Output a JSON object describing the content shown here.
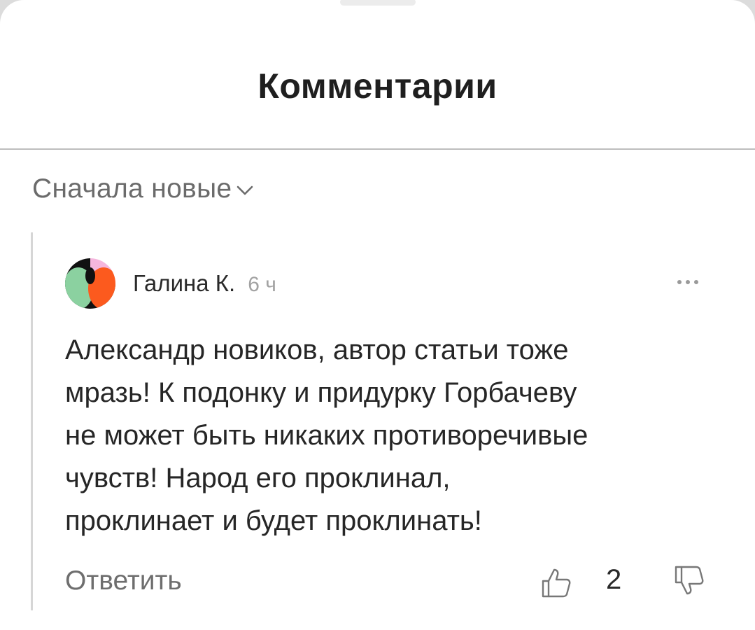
{
  "sheet": {
    "title": "Комментарии"
  },
  "sort": {
    "label": "Сначала новые",
    "icon": "chevron-down-icon"
  },
  "comment": {
    "author": "Галина К.",
    "time": "6 ч",
    "text": "Александр новиков, автор статьи тоже\nмразь! К подонку и придурку Горбачеву\nне может быть никаких противоречивые\nчувств! Народ его проклинал,\nпроклинает и будет проклинать!",
    "reply_label": "Ответить",
    "likes": "2",
    "more_icon": "more-horizontal-icon",
    "like_icon": "thumbs-up-icon",
    "dislike_icon": "thumbs-down-icon"
  },
  "colors": {
    "avatar_black": "#111111",
    "avatar_pink": "#f5b6dd",
    "avatar_green": "#8bd1a0",
    "avatar_orange": "#fc5a1e"
  }
}
